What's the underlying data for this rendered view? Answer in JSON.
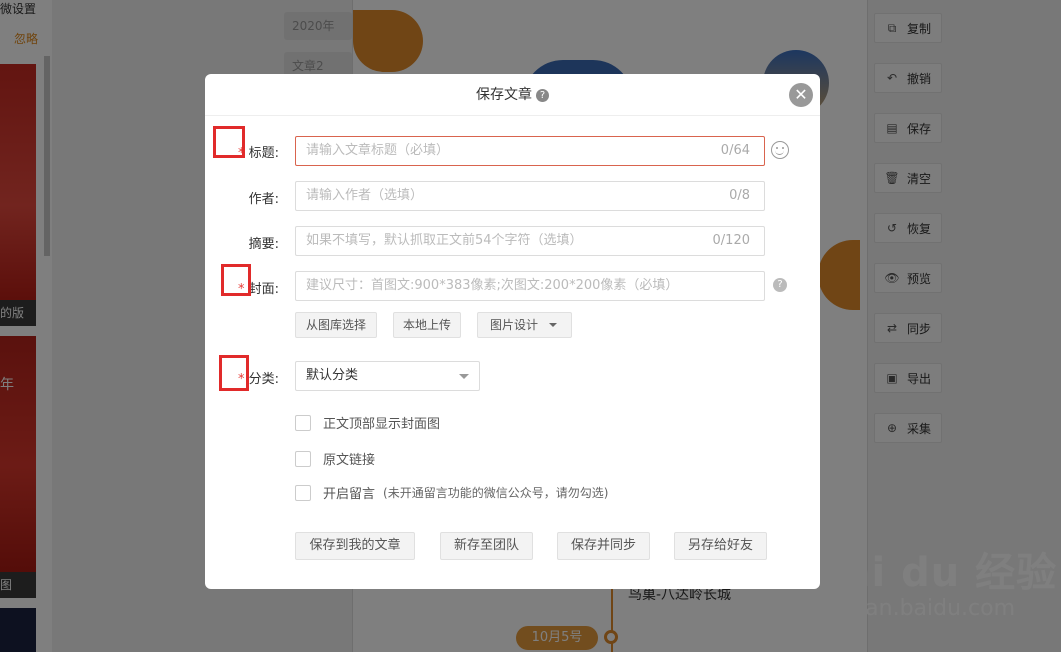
{
  "background": {
    "left_top_text": "微设置",
    "left_ignore": "忽略",
    "left_label_1": "的版",
    "left_year": "年",
    "left_label_2": "图",
    "file_tab_1": "2020年",
    "file_tab_2": "文章2",
    "timeline_date": "10月5号",
    "caption": "鸟巢-八达岭长城",
    "toolbar": [
      {
        "label": "复制",
        "icon": "copy-icon",
        "glyph": "⧉"
      },
      {
        "label": "撤销",
        "icon": "undo-icon",
        "glyph": "↶"
      },
      {
        "label": "保存",
        "icon": "save-icon",
        "glyph": "▤"
      },
      {
        "label": "清空",
        "icon": "trash-icon",
        "glyph": "🗑"
      },
      {
        "label": "恢复",
        "icon": "restore-icon",
        "glyph": "↺"
      },
      {
        "label": "预览",
        "icon": "eye-icon",
        "glyph": "👁"
      },
      {
        "label": "同步",
        "icon": "sync-icon",
        "glyph": "⇄"
      },
      {
        "label": "导出",
        "icon": "image-export-icon",
        "glyph": "▣"
      },
      {
        "label": "采集",
        "icon": "collect-search-icon",
        "glyph": "⊕"
      }
    ],
    "watermark_top": "Bai du 经验",
    "watermark_bottom": "jingyan.baidu.com"
  },
  "modal": {
    "title": "保存文章",
    "fields": {
      "title_label": "标题:",
      "title_placeholder": "请输入文章标题（必填）",
      "title_count": "0/64",
      "author_label": "作者:",
      "author_placeholder": "请输入作者（选填）",
      "author_count": "0/8",
      "summary_label": "摘要:",
      "summary_placeholder": "如果不填写，默认抓取正文前54个字符（选填）",
      "summary_count": "0/120",
      "cover_label": "封面:",
      "cover_placeholder": "建议尺寸：首图文:900*383像素;次图文:200*200像素（必填）",
      "category_label": "分类:",
      "category_value": "默认分类"
    },
    "cover_buttons": {
      "library": "从图库选择",
      "upload": "本地上传",
      "design": "图片设计"
    },
    "checks": {
      "show_cover": "正文顶部显示封面图",
      "original_link": "原文链接",
      "enable_comment": "开启留言",
      "comment_hint": "(未开通留言功能的微信公众号，请勿勾选)"
    },
    "actions": {
      "save_mine": "保存到我的文章",
      "save_team": "新存至团队",
      "save_sync": "保存并同步",
      "save_friend": "另存给好友"
    },
    "required_mark": "*"
  },
  "colors": {
    "accent_orange": "#e08a2a",
    "error_red": "#e12a2a"
  }
}
